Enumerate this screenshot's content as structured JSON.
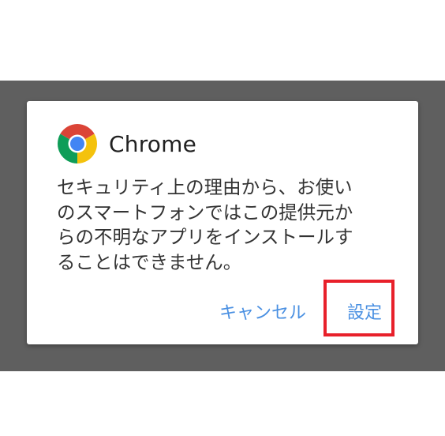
{
  "dialog": {
    "title": "Chrome",
    "message": "セキュリティ上の理由から、お使い\nのスマートフォンではこの提供元か\nらの不明なアプリをインストールす\nることはできません。",
    "buttons": {
      "cancel_label": "キャンセル",
      "settings_label": "設定"
    },
    "logo_icon": "chrome-logo-icon"
  },
  "annotation": {
    "highlight_color": "#e8202a"
  },
  "colors": {
    "scrim": "#5f5f5f",
    "button_text": "#4a90e2",
    "title_text": "#212121",
    "body_text": "#333333"
  }
}
